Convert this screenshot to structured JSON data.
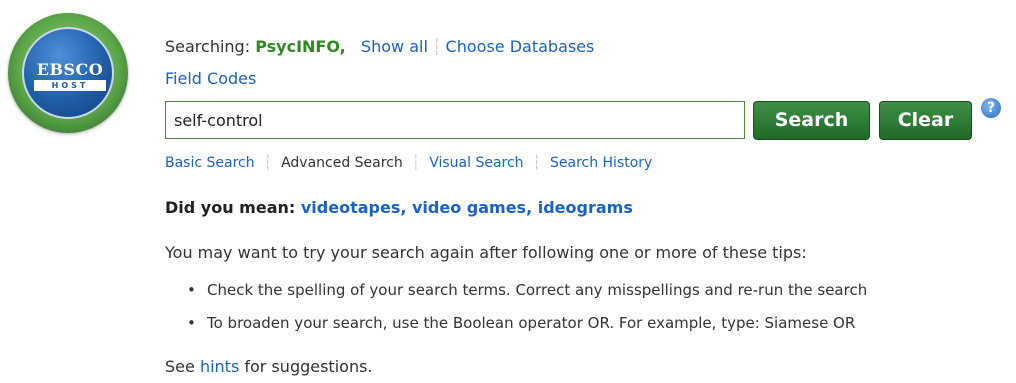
{
  "logo": {
    "word": "EBSCO",
    "sub": "HOST"
  },
  "searching": {
    "label": "Searching:",
    "database": "PsycINFO,",
    "show_all": "Show all",
    "choose_databases": "Choose Databases",
    "field_codes": "Field Codes"
  },
  "search": {
    "value": "self-control",
    "search_button": "Search",
    "clear_button": "Clear",
    "help_glyph": "?"
  },
  "sublinks": {
    "basic": "Basic Search",
    "advanced": "Advanced Search",
    "visual": "Visual Search",
    "history": "Search History"
  },
  "did_you_mean": {
    "label": "Did you mean:",
    "suggestions": [
      "videotapes,",
      "video games,",
      "ideograms"
    ]
  },
  "tips": {
    "intro": "You may want to try your search again after following one or more of these tips:",
    "items": [
      "Check the spelling of your search terms. Correct any misspellings and re-run the search",
      "To broaden your search, use the Boolean operator OR. For example, type: Siamese OR"
    ]
  },
  "hints": {
    "prefix": "See",
    "link": "hints",
    "suffix": "for suggestions."
  },
  "colors": {
    "link": "#1a63c5",
    "database": "#2e8b1e",
    "button_green": "#1f6b27",
    "input_border": "#4a8a3c"
  }
}
